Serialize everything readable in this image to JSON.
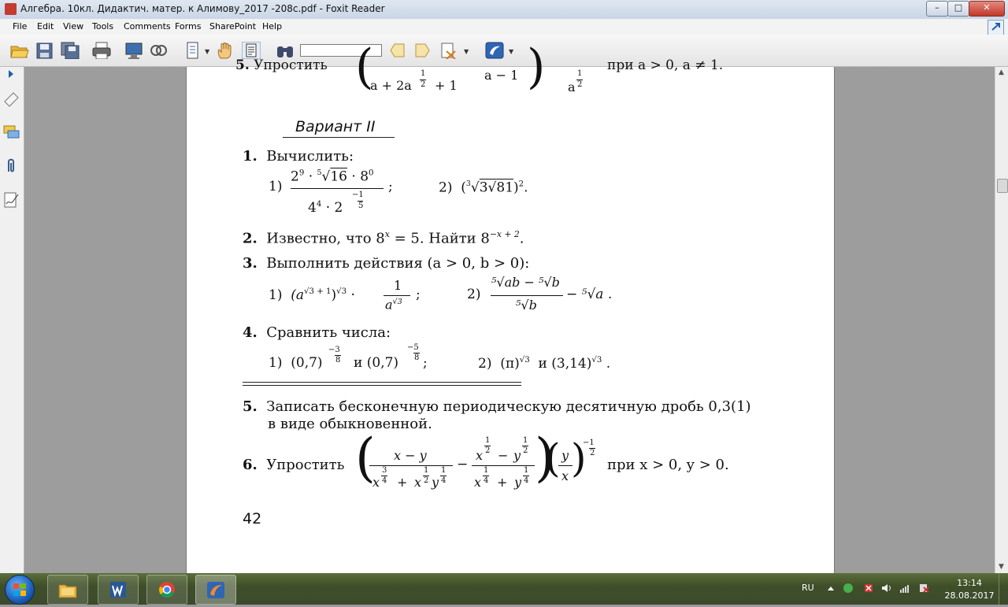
{
  "window": {
    "title": "Алгебра. 10кл. Дидактич. матер. к Алимову_2017 -208с.pdf - Foxit Reader",
    "min_glyph": "–",
    "max_glyph": "□",
    "close_glyph": "✕"
  },
  "menubar": {
    "items": [
      "File",
      "Edit",
      "View",
      "Tools",
      "Comments",
      "Forms",
      "SharePoint",
      "Help"
    ]
  },
  "toolbar": {
    "find_value": "",
    "icons": [
      "open-icon",
      "save-icon",
      "save-all-icon",
      "print-icon",
      "screen-icon",
      "scan-icon",
      "pages-icon",
      "hand-icon",
      "select-text-icon",
      "binoculars-icon",
      "find-prev-icon",
      "find-next-icon",
      "find-options-icon",
      "foxit-icon"
    ]
  },
  "leftpanel": {
    "icons": [
      "expand-arrow-icon",
      "bookmark-icon",
      "comments-icon",
      "attachment-icon",
      "signature-icon"
    ]
  },
  "doc": {
    "prev_tail": {
      "num": "5.",
      "verb": "Упростить",
      "cond": "при a > 0, a ≠ 1.",
      "den1": "a + 2a",
      "den1_exp_n": "1",
      "den1_exp_d": "2",
      "den1_tail": "+ 1",
      "den2": "a − 1",
      "den3": "a",
      "den3_exp_n": "1",
      "den3_exp_d": "2"
    },
    "variant": "Вариант II",
    "p1": {
      "num": "1.",
      "text": "Вычислить:",
      "a_label": "1)",
      "a_num_2": "2",
      "a_num_2e": "9",
      "dot": "·",
      "a_root_idx": "5",
      "a_root_rad": "16",
      "a_num_8": "8",
      "a_num_8e": "0",
      "a_den_4": "4",
      "a_den_4e": "4",
      "a_den_2": "2",
      "a_den_2e_n": "1",
      "a_den_2e_d": "5",
      "semi": ";",
      "b_label": "2)",
      "b_expr_open": "(",
      "b_root_idx": "3",
      "b_three": "3",
      "b_rad": "81",
      "b_expr_close": ")",
      "b_exp": "2",
      "b_end": "."
    },
    "p2": {
      "num": "2.",
      "text": "Известно, что 8",
      "x_exp": "x",
      "text2": " = 5. Найти 8",
      "exp2": "−x + 2",
      "end": "."
    },
    "p3": {
      "num": "3.",
      "text": "Выполнить действия (a > 0, b > 0):",
      "a_label": "1)",
      "a_base": "(a",
      "a_exp": "√3 + 1",
      "a_close": ")",
      "a_exp2": "√3",
      "a_dot": "·",
      "a_fnum": "1",
      "a_fden": "a",
      "a_fden_exp": "√3",
      "a_semi": ";",
      "b_label": "2)",
      "b_num": "⁵√ab − ⁵√b",
      "b_den": "⁵√b",
      "b_tail": "− ⁵√a ."
    },
    "p4": {
      "num": "4.",
      "text": "Сравнить числа:",
      "a_label": "1)",
      "a_1": "(0,7)",
      "a_1e_n": "3",
      "a_1e_d": "8",
      "minus": "−",
      "a_and": "и",
      "a_2": "(0,7)",
      "a_2e_n": "5",
      "a_2e_d": "8",
      "a_semi": ";",
      "b_label": "2)",
      "b_1": "(π)",
      "b_1e": "√3",
      "b_and": "и",
      "b_2": "(3,14)",
      "b_2e": "√3",
      "b_end": "."
    },
    "p5": {
      "num": "5.",
      "line1": "Записать бесконечную периодическую десятичную дробь 0,3(1)",
      "line2": "в виде обыкновенной."
    },
    "p6": {
      "num": "6.",
      "verb": "Упростить",
      "f1_num": "x − y",
      "f1_den_a": "x",
      "f1_den_a_n": "3",
      "f1_den_a_d": "4",
      "plus": "+",
      "f1_den_b": "x",
      "f1_den_b_n": "1",
      "f1_den_b_d": "2",
      "f1_den_c": "y",
      "f1_den_c_n": "1",
      "f1_den_c_d": "4",
      "mid_minus": "−",
      "f2_num_a": "x",
      "f2_num_a_n": "1",
      "f2_num_a_d": "2",
      "f2_num_b": "y",
      "f2_num_b_n": "1",
      "f2_num_b_d": "2",
      "f2_den_a": "x",
      "f2_den_a_n": "1",
      "f2_den_a_d": "4",
      "f2_den_b": "y",
      "f2_den_b_n": "1",
      "f2_den_b_d": "4",
      "f3_num": "y",
      "f3_den": "x",
      "outer_exp_n": "1",
      "outer_exp_d": "2",
      "cond": "при x > 0, y > 0."
    },
    "page_number": "42"
  },
  "taskbar": {
    "apps": [
      "explorer-icon",
      "word-icon",
      "chrome-icon",
      "foxit-reader-icon"
    ],
    "lang": "RU",
    "time": "13:14",
    "date": "28.08.2017"
  },
  "colors": {
    "accent": "#1c5fb8",
    "foxit_red": "#c43b2f"
  }
}
